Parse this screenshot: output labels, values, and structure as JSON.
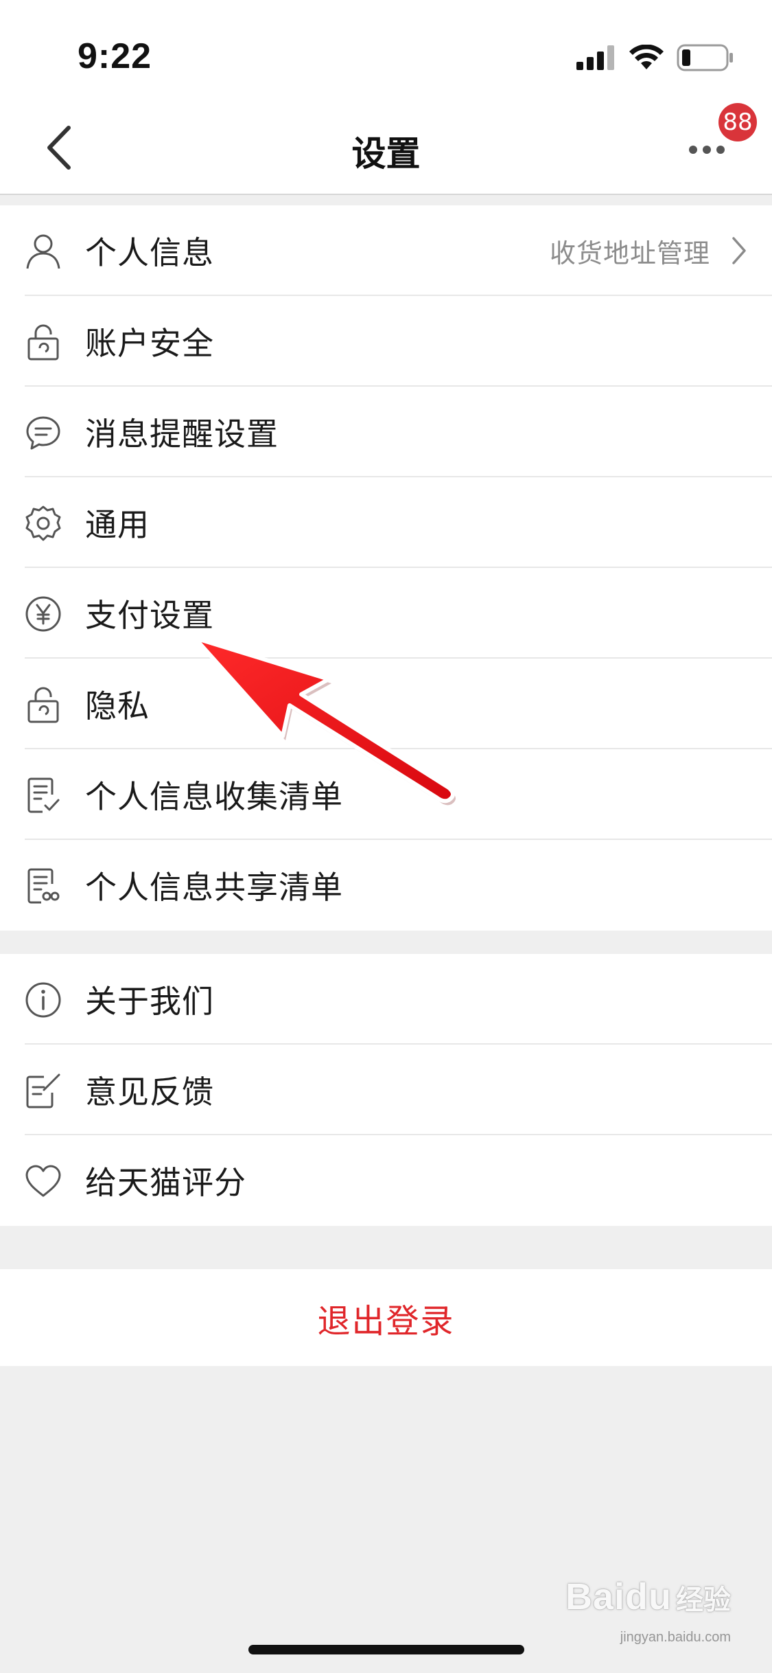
{
  "status_bar": {
    "time": "9:22"
  },
  "nav": {
    "title": "设置",
    "badge_count": "88",
    "badge_color": "#d9343a"
  },
  "group1": [
    {
      "id": "personal-info",
      "label": "个人信息",
      "icon": "user-icon",
      "right_text": "收货地址管理"
    },
    {
      "id": "account-security",
      "label": "账户安全",
      "icon": "lock-icon"
    },
    {
      "id": "message-reminder",
      "label": "消息提醒设置",
      "icon": "chat-bubble-icon"
    },
    {
      "id": "general",
      "label": "通用",
      "icon": "gear-icon"
    },
    {
      "id": "payment-settings",
      "label": "支付设置",
      "icon": "yen-icon"
    },
    {
      "id": "privacy",
      "label": "隐私",
      "icon": "lock-icon"
    },
    {
      "id": "info-collection-list",
      "label": "个人信息收集清单",
      "icon": "checklist-icon"
    },
    {
      "id": "info-sharing-list",
      "label": "个人信息共享清单",
      "icon": "shared-list-icon"
    }
  ],
  "group2": [
    {
      "id": "about-us",
      "label": "关于我们",
      "icon": "info-icon"
    },
    {
      "id": "feedback",
      "label": "意见反馈",
      "icon": "edit-note-icon"
    },
    {
      "id": "rate-tmall",
      "label": "给天猫评分",
      "icon": "heart-icon"
    }
  ],
  "logout": {
    "label": "退出登录",
    "color": "#e0262a"
  },
  "annotation": {
    "arrow_color": "#e8101a"
  },
  "watermark": {
    "brand": "Bai",
    "brand2": "du",
    "suffix": "经验",
    "url": "jingyan.baidu.com"
  }
}
